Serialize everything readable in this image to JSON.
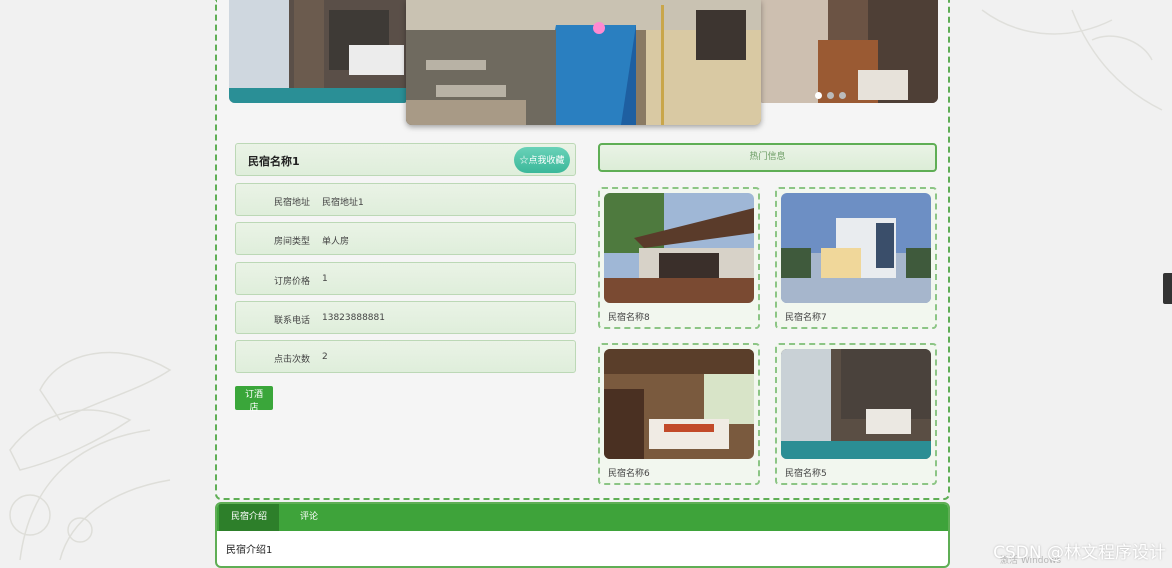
{
  "carousel": {
    "slides": 3,
    "active_dot": 0
  },
  "detail": {
    "name": "民宿名称1",
    "favorite_label": "☆点我收藏",
    "rows": [
      {
        "label": "民宿地址",
        "value": "民宿地址1"
      },
      {
        "label": "房间类型",
        "value": "单人房"
      },
      {
        "label": "订房价格",
        "value": "1"
      },
      {
        "label": "联系电话",
        "value": "13823888881"
      },
      {
        "label": "点击次数",
        "value": "2"
      }
    ],
    "book_label": "订酒店"
  },
  "hot": {
    "title": "热门信息",
    "items": [
      {
        "name": "民宿名称8"
      },
      {
        "name": "民宿名称7"
      },
      {
        "name": "民宿名称6"
      },
      {
        "name": "民宿名称5"
      }
    ]
  },
  "tabs": {
    "items": [
      {
        "label": "民宿介绍"
      },
      {
        "label": "评论"
      }
    ],
    "active": 0,
    "content": "民宿介绍1"
  },
  "overlay": {
    "watermark": "CSDN @林文程序设计",
    "windows_note": "激活 Windows"
  },
  "colors": {
    "accent_green": "#3ea33a",
    "border_green": "#5fae55",
    "teal": "#3bb89a"
  }
}
